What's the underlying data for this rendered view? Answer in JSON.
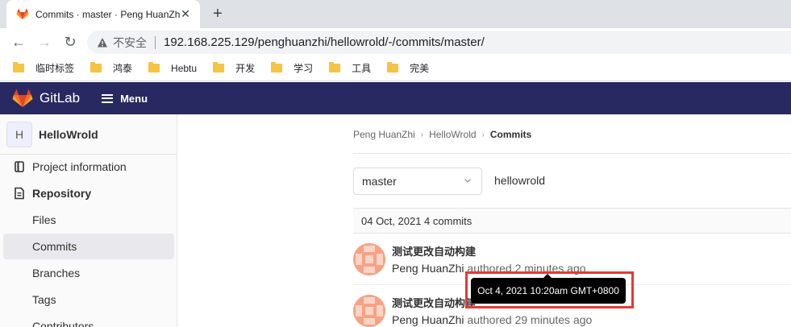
{
  "browser": {
    "tab_title": "Commits · master · Peng HuanZhi / HelloWrold · GitLab",
    "address": {
      "security_label": "不安全",
      "url": "192.168.225.129/penghuanzhi/hellowrold/-/commits/master/"
    },
    "bookmarks": [
      {
        "label": "临时标签"
      },
      {
        "label": "鸿泰"
      },
      {
        "label": "Hebtu"
      },
      {
        "label": "开发"
      },
      {
        "label": "学习"
      },
      {
        "label": "工具"
      },
      {
        "label": "完美"
      }
    ]
  },
  "gitlab": {
    "brand": "GitLab",
    "menu_label": "Menu",
    "colors": {
      "header_bg": "#292961",
      "accent": "#fc6d26"
    }
  },
  "sidebar": {
    "project_initial": "H",
    "project_name": "HelloWrold",
    "items": [
      {
        "label": "Project information",
        "icon": "project-information-icon"
      },
      {
        "label": "Repository",
        "icon": "repository-icon"
      },
      {
        "label": "Files"
      },
      {
        "label": "Commits"
      },
      {
        "label": "Branches"
      },
      {
        "label": "Tags"
      },
      {
        "label": "Contributors"
      }
    ]
  },
  "breadcrumb": {
    "items": [
      "Peng HuanZhi",
      "HelloWrold",
      "Commits"
    ]
  },
  "filter": {
    "branch": "master",
    "project_path": "hellowrold"
  },
  "commits": {
    "day_header": "04 Oct, 2021 4 commits",
    "rows": [
      {
        "title": "测试更改自动构建",
        "author": "Peng HuanZhi",
        "action": " authored ",
        "time": "2 minutes ago"
      },
      {
        "title": "测试更改自动构建",
        "author": "Peng HuanZhi",
        "action": " authored ",
        "time": "29 minutes ago"
      }
    ]
  },
  "tooltip": {
    "text": "Oct 4, 2021 10:20am GMT+0800"
  }
}
